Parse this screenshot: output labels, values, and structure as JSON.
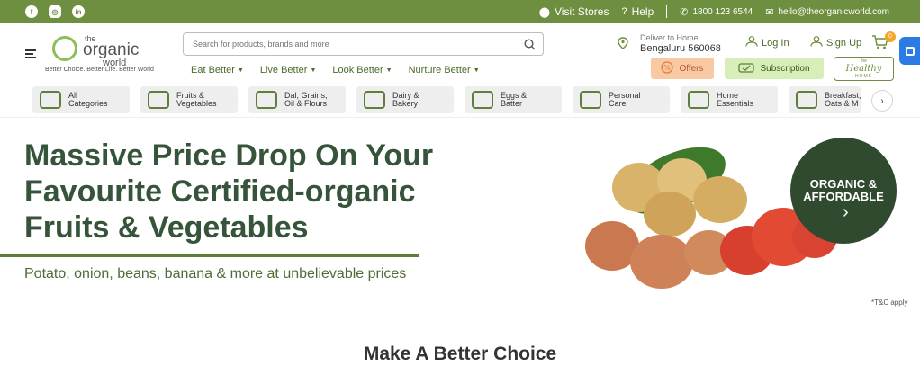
{
  "topbar": {
    "social": [
      "facebook-icon",
      "instagram-icon",
      "linkedin-icon"
    ],
    "visit_stores": "Visit Stores",
    "help": "Help",
    "phone": "1800 123 6544",
    "email": "hello@theorganicworld.com"
  },
  "header": {
    "logo": {
      "the": "the",
      "organic": "organic",
      "world": "world",
      "tagline": "Better Choice. Better Life. Better World"
    },
    "search_placeholder": "Search for products, brands and more",
    "nav": [
      "Eat Better",
      "Live Better",
      "Look Better",
      "Nurture Better"
    ],
    "deliver_label": "Deliver to Home",
    "deliver_location": "Bengaluru 560068",
    "login": "Log In",
    "signup": "Sign Up",
    "cart_count": "0",
    "offers": "Offers",
    "subscription": "Subscription",
    "healthy_home": {
      "top": "the",
      "mid": "Healthy",
      "bottom": "HOME"
    }
  },
  "categories": [
    "All\nCategories",
    "Fruits &\nVegetables",
    "Dal, Grains,\nOil & Flours",
    "Dairy &\nBakery",
    "Eggs &\nBatter",
    "Personal\nCare",
    "Home\nEssentials",
    "Breakfast,\nOats & M"
  ],
  "banner": {
    "headline_1": "Massive Price Drop On Your",
    "headline_2": "Favourite Certified-organic",
    "headline_3": "Fruits & Vegetables",
    "subline": "Potato, onion, beans, banana & more at unbelievable prices",
    "badge_1": "ORGANIC &",
    "badge_2": "AFFORDABLE",
    "tnc": "*T&C apply"
  },
  "section_title": "Make A Better Choice",
  "colors": {
    "brand_green": "#6e8f3f",
    "dark_green": "#35543a",
    "offers_bg": "#f9c9a3",
    "subscription_bg": "#d8eeb8",
    "accent_blue": "#2c7be5"
  }
}
